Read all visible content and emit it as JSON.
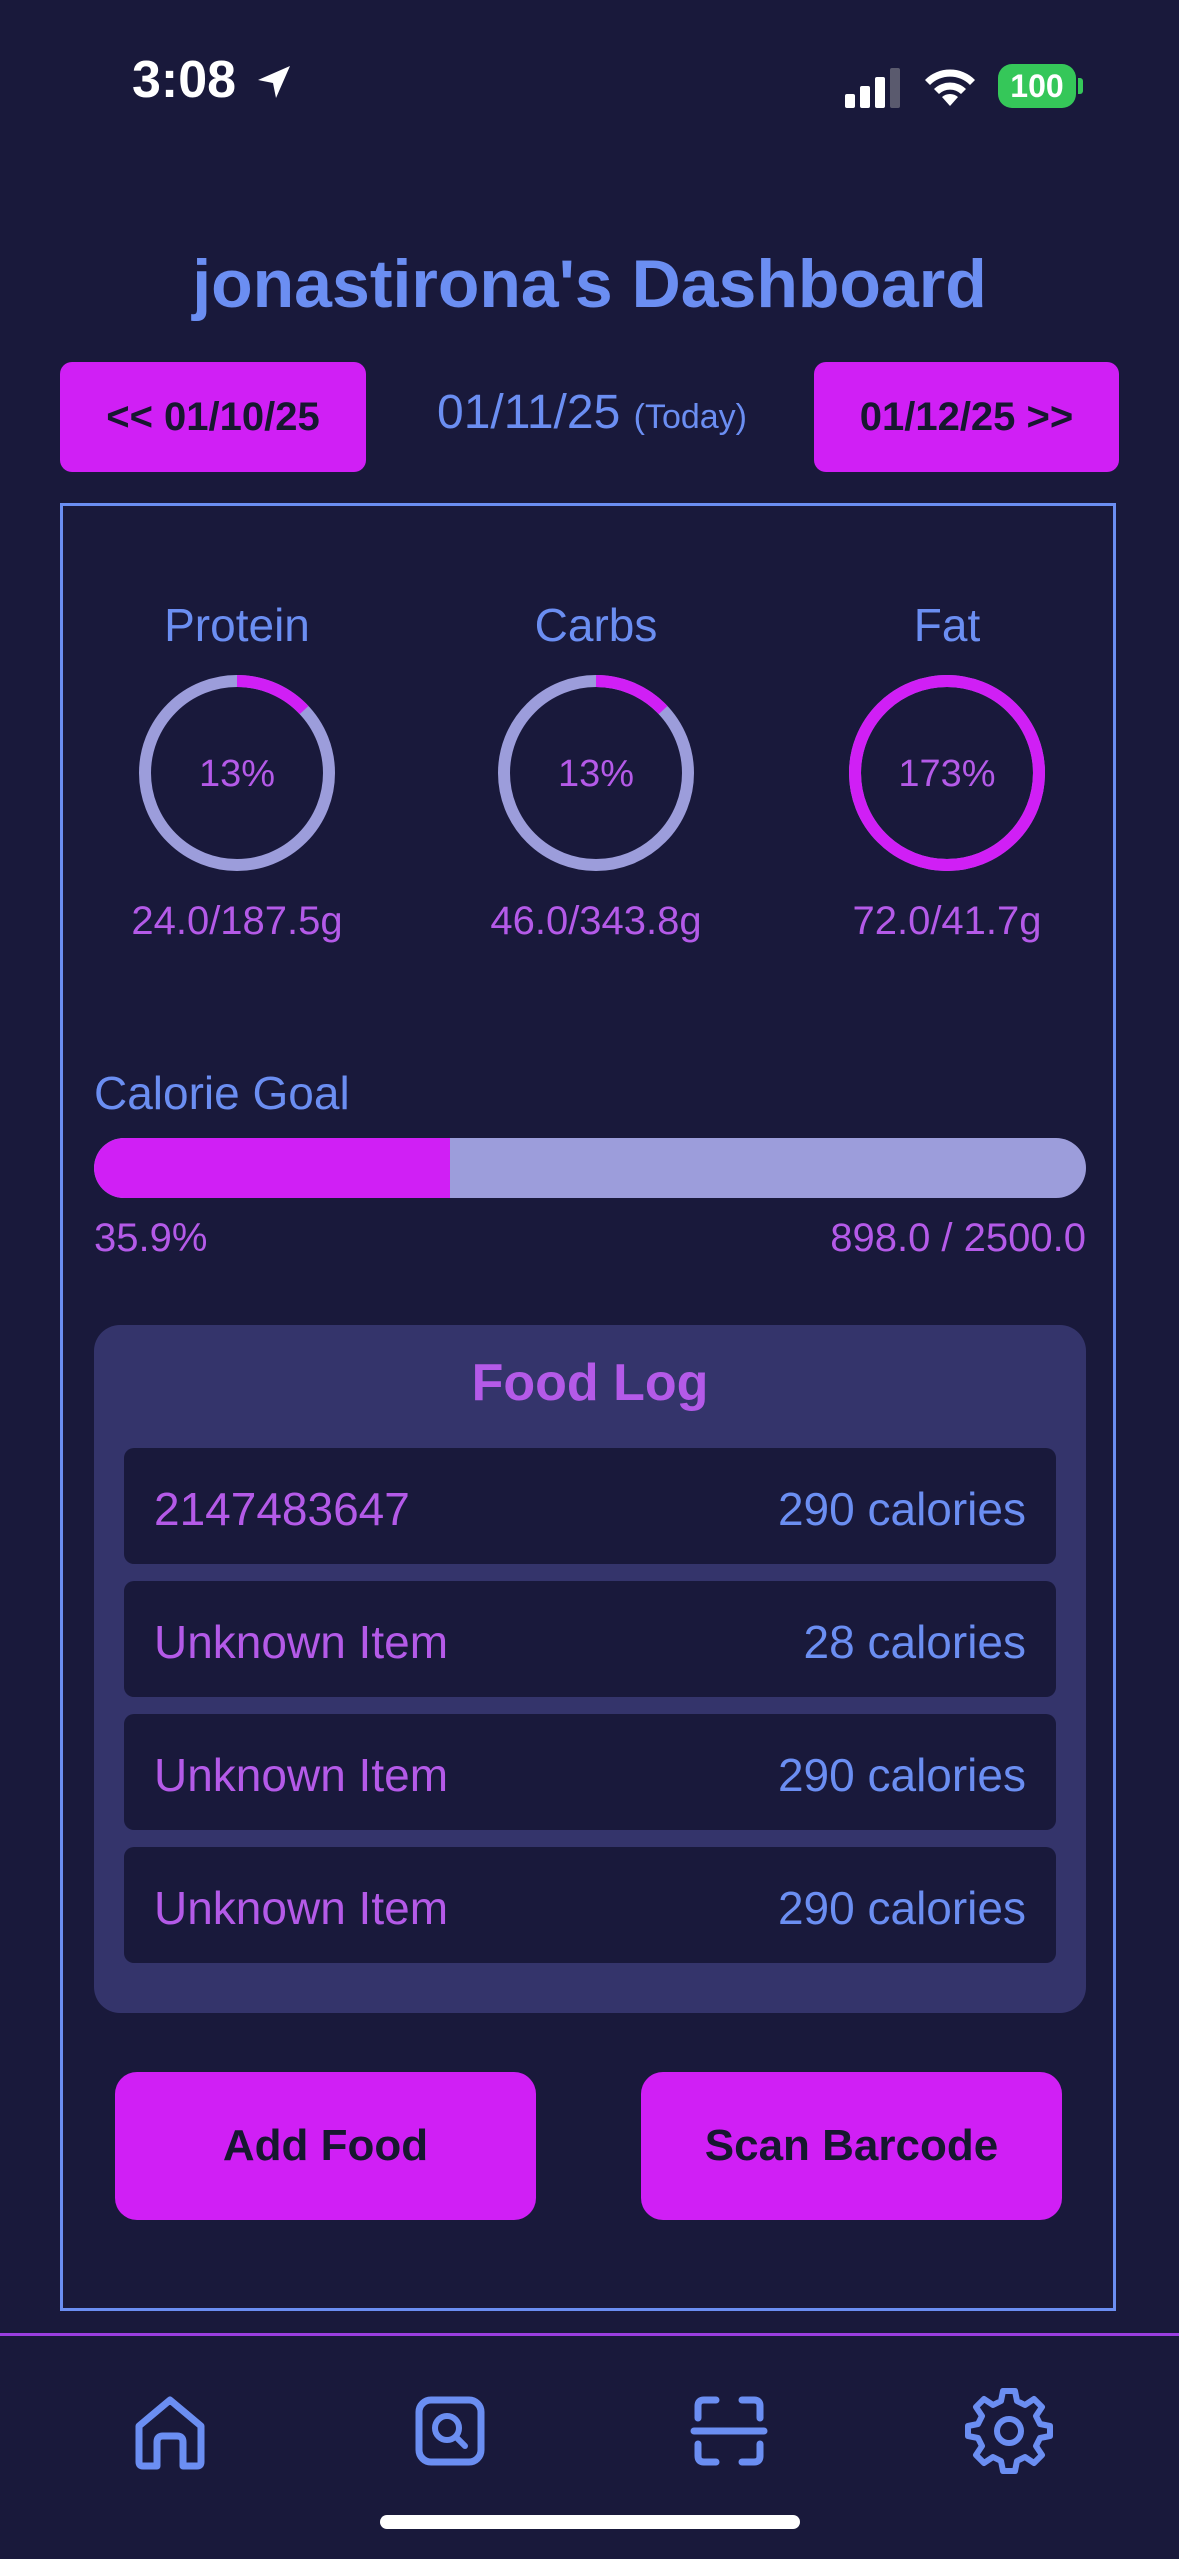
{
  "status_bar": {
    "time": "3:08",
    "battery": "100",
    "icons": [
      "location-arrow-icon",
      "cellular-signal-icon",
      "wifi-icon",
      "battery-icon"
    ]
  },
  "header": {
    "title": "jonastirona's Dashboard"
  },
  "date_nav": {
    "prev_label": "<< 01/10/25",
    "current_date": "01/11/25",
    "current_note": "(Today)",
    "next_label": "01/12/25 >>"
  },
  "macros": [
    {
      "label": "Protein",
      "percent_text": "13%",
      "percent": 13,
      "values": "24.0/187.5g"
    },
    {
      "label": "Carbs",
      "percent_text": "13%",
      "percent": 13,
      "values": "46.0/343.8g"
    },
    {
      "label": "Fat",
      "percent_text": "173%",
      "percent": 173,
      "values": "72.0/41.7g"
    }
  ],
  "calorie_goal": {
    "label": "Calorie Goal",
    "percent_text": "35.9%",
    "fraction": 0.359,
    "count": "898.0 / 2500.0"
  },
  "food_log": {
    "title": "Food Log",
    "items": [
      {
        "name": "2147483647",
        "calories": "290 calories"
      },
      {
        "name": "Unknown Item",
        "calories": "28 calories"
      },
      {
        "name": "Unknown Item",
        "calories": "290 calories"
      },
      {
        "name": "Unknown Item",
        "calories": "290 calories"
      }
    ]
  },
  "actions": {
    "add_food": "Add Food",
    "scan_barcode": "Scan Barcode"
  },
  "tab_bar": {
    "items": [
      "home-icon",
      "search-icon",
      "barcode-scan-icon",
      "settings-gear-icon"
    ]
  },
  "colors": {
    "background": "#19193b",
    "accent_magenta": "#d01ff5",
    "blue_text": "#6b8ef2",
    "purple_text": "#b45ae8",
    "ring_track": "#9c9ddb",
    "card": "#34346b"
  }
}
